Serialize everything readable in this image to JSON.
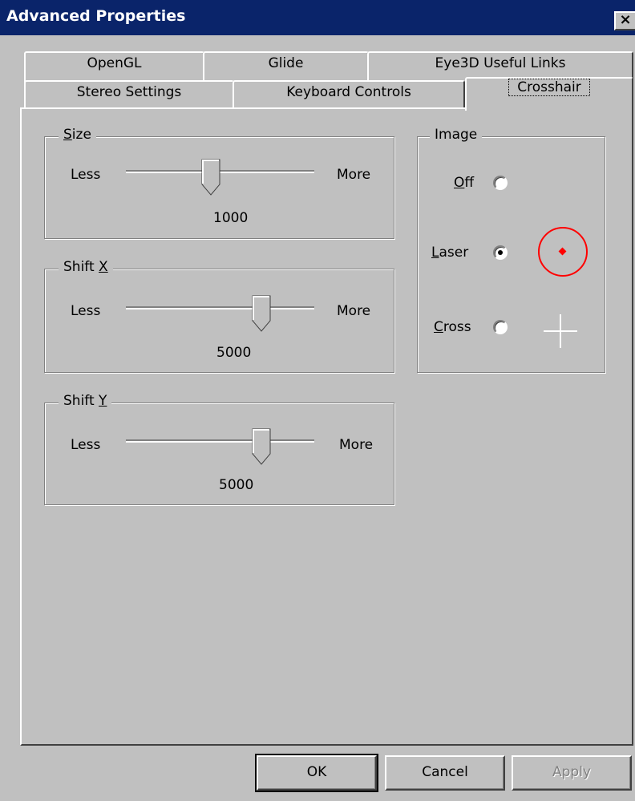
{
  "window": {
    "title": "Advanced Properties",
    "close_glyph": "×"
  },
  "tabs": {
    "back_row": [
      "OpenGL",
      "Glide",
      "Eye3D Useful Links"
    ],
    "front_row": [
      "Stereo Settings",
      "Keyboard Controls",
      "Crosshair"
    ],
    "active": "Crosshair"
  },
  "size": {
    "legend_key": "S",
    "legend_rest": "ize",
    "less": "Less",
    "more": "More",
    "value": "1000",
    "level": 0.45
  },
  "shift_x": {
    "legend_pre": "Shift ",
    "legend_key": "X",
    "less": "Less",
    "more": "More",
    "value": "5000",
    "level": 0.72
  },
  "shift_y": {
    "legend_pre": "Shift ",
    "legend_key": "Y",
    "less": "Less",
    "more": "More",
    "value": "5000",
    "level": 0.72
  },
  "image": {
    "legend": "Image",
    "options": [
      {
        "key": "O",
        "rest": "ff",
        "selected": false,
        "icon": "none"
      },
      {
        "key": "L",
        "rest": "aser",
        "selected": true,
        "icon": "laser-icon"
      },
      {
        "key": "C",
        "rest": "ross",
        "selected": false,
        "icon": "cross-icon"
      }
    ],
    "laser_color": "#ff0000",
    "cross_color": "#ffffff"
  },
  "buttons": {
    "ok": "OK",
    "cancel": "Cancel",
    "apply": "Apply",
    "apply_disabled": true
  }
}
